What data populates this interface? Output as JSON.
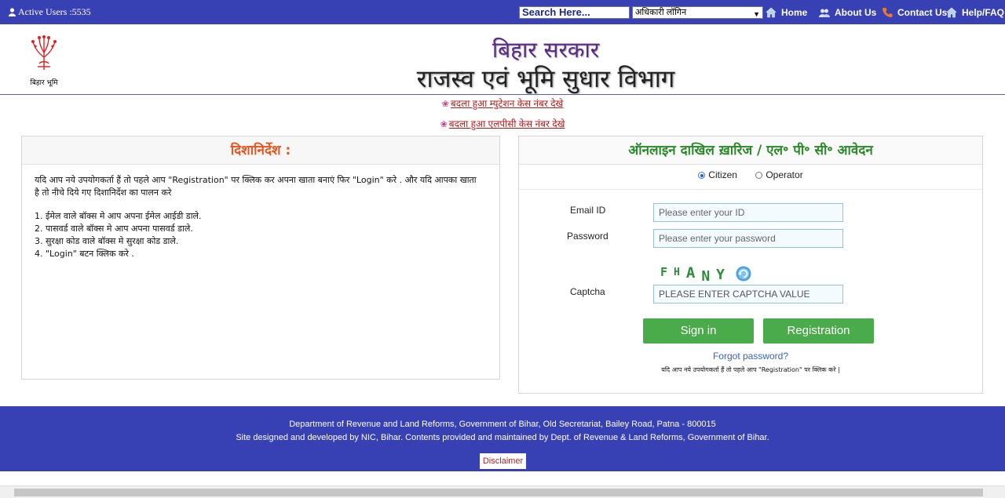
{
  "topbar": {
    "active_users": "Active Users :5535",
    "search_placeholder": "Search Here...",
    "login_select": "अधिकारी लॉगिन",
    "nav": {
      "home": "Home",
      "about": "About Us",
      "contact": "Contact Us",
      "help": "Help/FAQ"
    }
  },
  "header": {
    "logo_text": "बिहार भूमि",
    "title1": "बिहार सरकार",
    "title2": "राजस्व एवं भूमि सुधार विभाग"
  },
  "notices": [
    "बदला हुआ म्युटेशन केस नंबर देखे",
    "बदला हुआ एलपीसी केस नंबर देखे"
  ],
  "guidelines": {
    "title": "दिशानिर्देश :",
    "intro_1": "यदि आप नये उपयोगकर्ता हैं तो पहले आप \"Registration\" पर क्लिक कर अपना खाता बनाएं फिर \"Login\" करे . और यदि आपका खाता",
    "intro_2": "है तो नीचे दिये गए दिशानिर्देश का पालन करे",
    "steps": [
      "1. ईमेल वाले बॉक्स मे आप अपना ईमेल आईडी डाले.",
      "2. पासवर्ड वाले बॉक्स मे आप अपना पासवर्ड डाले.",
      "3. सुरक्षा कोड वाले बॉक्स मे सुरक्षा कोड डाले.",
      "4. \"Login\" बटन क्लिक करे ."
    ]
  },
  "login": {
    "title": "ऑनलाइन दाखिल ख़ारिज / एल॰ पी॰ सी॰ आवेदन",
    "role_citizen": "Citizen",
    "role_operator": "Operator",
    "selected_role": "Citizen",
    "email_label": "Email ID",
    "email_placeholder": "Please enter your ID",
    "password_label": "Password",
    "password_placeholder": "Please enter your password",
    "captcha_label": "Captcha",
    "captcha_chars": [
      "F",
      "H",
      "A",
      "N",
      "Y"
    ],
    "captcha_placeholder": "PLEASE ENTER CAPTCHA VALUE",
    "signin": "Sign in",
    "registration": "Registration",
    "forgot": "Forgot password?",
    "reg_note": "यदि आप नये उपयोगकर्ता हैं तो पहले आप \"Registration\" पर क्लिक करे |"
  },
  "footer": {
    "line1": "Department of Revenue and Land Reforms, Government of Bihar, Old Secretariat, Bailey Road, Patna - 800015",
    "line2": "Site designed and developed by NIC, Bihar. Contents provided and maintained by Dept. of Revenue & Land Reforms, Government of Bihar.",
    "disclaimer": "Disclaimer"
  },
  "colors": {
    "brand_blue": "#3841b4",
    "guide_title": "#e8541e",
    "login_title": "#2a8a2a",
    "button_green": "#4aab4a",
    "link_red": "#b01c1c"
  }
}
